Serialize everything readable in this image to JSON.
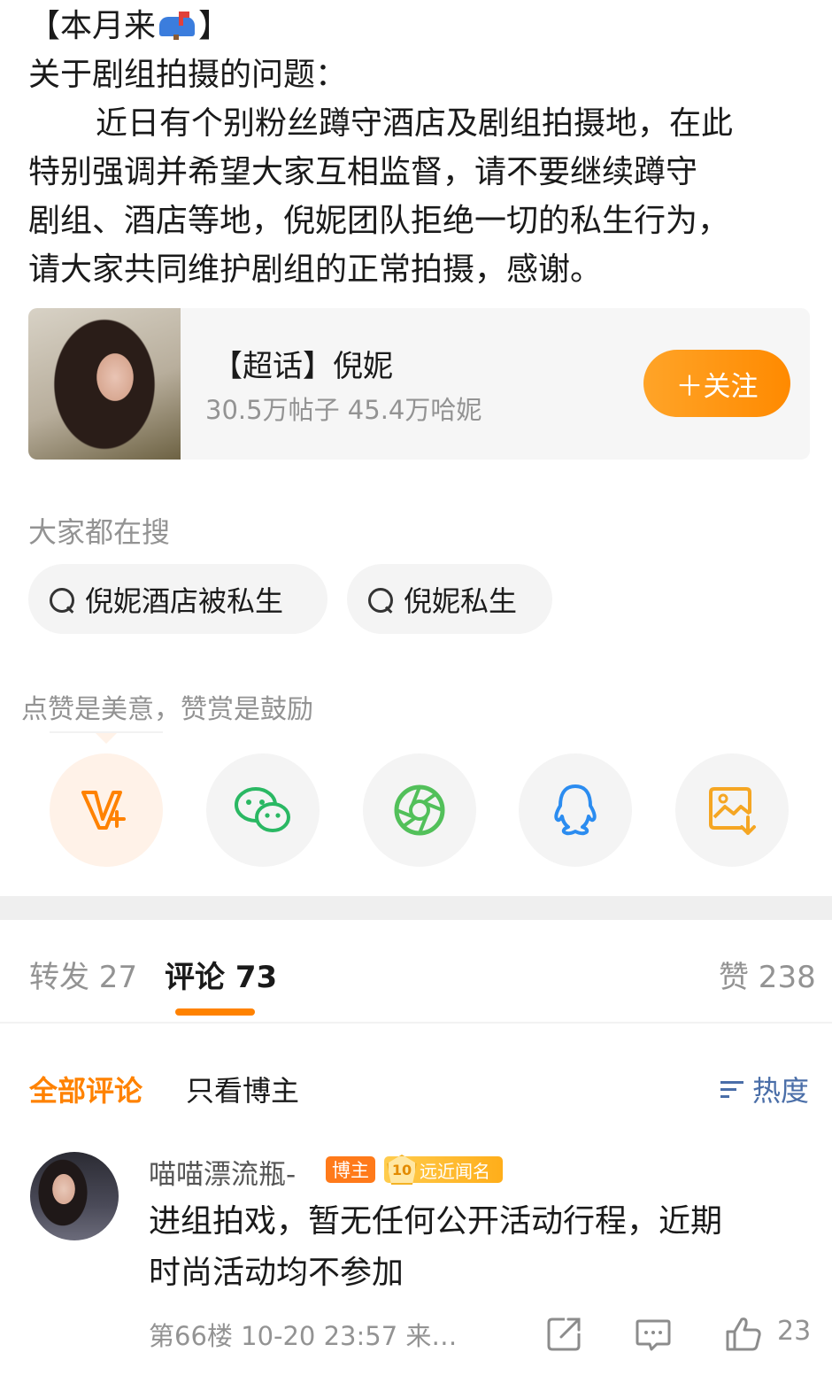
{
  "post": {
    "line1_prefix": "【本月来",
    "line1_suffix": "】",
    "line2": "关于剧组拍摄的问题：",
    "line3": "近日有个别粉丝蹲守酒店及剧组拍摄地，在此",
    "line4": "特别强调并希望大家互相监督，请不要继续蹲守",
    "line5": "剧组、酒店等地，倪妮团队拒绝一切的私生行为，",
    "line6": "请大家共同维护剧组的正常拍摄，感谢。",
    "mailbox_icon": "mailbox-emoji-icon"
  },
  "topic_card": {
    "title": "【超话】倪妮",
    "stats": "30.5万帖子 45.4万哈妮",
    "follow_label": "＋关注",
    "accent": "#ff8a00"
  },
  "search": {
    "heading": "大家都在搜",
    "items": [
      "倪妮酒店被私生",
      "倪妮私生"
    ]
  },
  "reward": {
    "tip": "点赞是美意，赞赏是鼓励"
  },
  "share": {
    "items": [
      "reward-v-icon",
      "wechat-icon",
      "moments-icon",
      "qq-icon",
      "save-image-icon"
    ]
  },
  "tabs": {
    "repost": "转发 27",
    "comment": "评论 73",
    "like": "赞 238"
  },
  "filters": {
    "all": "全部评论",
    "owner_only": "只看博主",
    "sort": "热度"
  },
  "comment": {
    "user": "喵喵漂流瓶-",
    "blogger_badge": "博主",
    "fan_level": "10",
    "fan_badge": "远近闻名",
    "text_line1": "进组拍戏，暂无任何公开活动行程，近期",
    "text_line2": "时尚活动均不参加",
    "meta": "第66楼 10-20 23:57 来…",
    "like_count": "23"
  }
}
